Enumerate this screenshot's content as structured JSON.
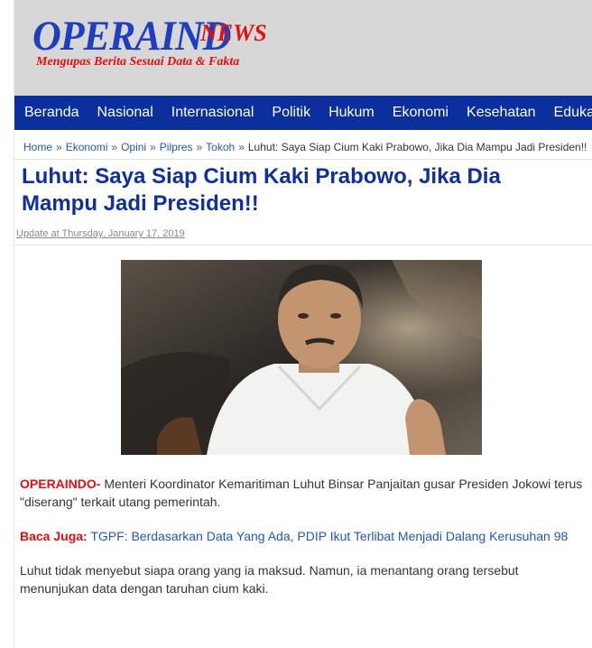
{
  "site": {
    "logo_main": "OPERAIND",
    "logo_news": "NEWS",
    "tagline": "Mengupas Berita Sesuai Data & Fakta"
  },
  "nav": {
    "items": [
      "Beranda",
      "Nasional",
      "Internasional",
      "Politik",
      "Hukum",
      "Ekonomi",
      "Kesehatan",
      "Edukasi"
    ]
  },
  "breadcrumb": {
    "items": [
      "Home",
      "Ekonomi",
      "Opini",
      "Pilpres",
      "Tokoh"
    ],
    "current": "Luhut: Saya Siap Cium Kaki Prabowo, Jika Dia Mampu Jadi Presiden!!",
    "separator": "»"
  },
  "article": {
    "title": "Luhut: Saya Siap Cium Kaki Prabowo, Jika Dia Mampu Jadi Presiden!!",
    "update": "Update at Thursday, January 17, 2019",
    "p1_source": "OPERAINDO-",
    "p1_text": " Menteri Koordinator Kemaritiman Luhut Binsar Panjaitan gusar Presiden Jokowi terus \"diserang\" terkait utang pemerintah.",
    "baca_label": "Baca Juga:",
    "baca_link": "TGPF: Berdasarkan Data Yang Ada, PDIP Ikut Terlibat Menjadi Dalang Kerusuhan 98",
    "p2": "Luhut tidak menyebut siapa orang yang ia maksud. Namun, ia menantang orang tersebut menunjukan data dengan taruhan cium kaki."
  },
  "colors": {
    "nav_bg": "#0b2f9c",
    "title": "#0d2fa0",
    "accent_red": "#e01010",
    "link": "#1f55c5",
    "header_bg": "#d7d7d7"
  }
}
